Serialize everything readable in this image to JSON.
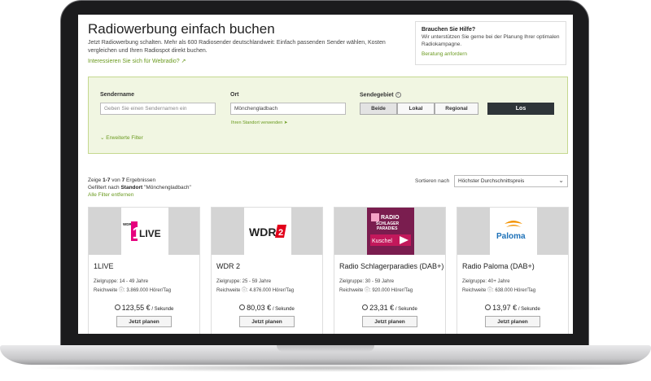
{
  "page": {
    "title": "Radiowerbung einfach buchen",
    "intro": "Jetzt Radiowerbung schalten. Mehr als 600 Radiosender deutschlandweit: Einfach passenden Sender wählen, Kosten vergleichen und Ihren Radiospot direkt buchen.",
    "webradio_link": "Interessieren Sie sich für Webradio?"
  },
  "help": {
    "title": "Brauchen Sie Hilfe?",
    "text": "Wir unterstützen Sie gerne bei der Planung Ihrer optimalen Radiokampagne.",
    "link": "Beratung anfordern"
  },
  "filter": {
    "sender_label": "Sendername",
    "sender_placeholder": "Geben Sie einen Sendernamen ein",
    "ort_label": "Ort",
    "ort_value": "Mönchengladbach",
    "location_link": "Ihren Standort verwenden",
    "gebiet_label": "Sendegebiet",
    "gebiet_options": [
      "Beide",
      "Lokal",
      "Regional"
    ],
    "submit": "Los",
    "advanced": "Erweiterte Filter"
  },
  "results": {
    "prefix": "Zeige ",
    "range": "1-7",
    "mid": " von ",
    "total": "7",
    "suffix": " Ergebnissen",
    "filtered_prefix": "Gefiltert nach ",
    "filtered_key": "Standort",
    "filtered_value": " \"Mönchengladbach\"",
    "reset": "Alle Filter entfernen",
    "sort_label": "Sortieren nach",
    "sort_value": "Höchster Durchschnittspreis"
  },
  "cards": [
    {
      "name": "1LIVE",
      "zielgruppe": "Zielgruppe: 14 - 49 Jahre",
      "reichweite": "Reichweite ⓘ: 3.869.000 Hörer/Tag",
      "price": "123,55 €",
      "unit": " / Sekunde",
      "button": "Jetzt planen",
      "logo": "1LIVE"
    },
    {
      "name": "WDR 2",
      "zielgruppe": "Zielgruppe: 25 - 59 Jahre",
      "reichweite": "Reichweite ⓘ: 4.876.000 Hörer/Tag",
      "price": "80,03 €",
      "unit": " / Sekunde",
      "button": "Jetzt planen",
      "logo": "WDR 2"
    },
    {
      "name": "Radio Schlagerparadies (DAB+)",
      "zielgruppe": "Zielgruppe: 30 - 59 Jahre",
      "reichweite": "Reichweite ⓘ: 920.000 Hörer/Tag",
      "price": "23,31 €",
      "unit": " / Sekunde",
      "button": "Jetzt planen",
      "logo": "RADIO SCHLAGER PARADIES Kuschelsongs"
    },
    {
      "name": "Radio Paloma (DAB+)",
      "zielgruppe": "Zielgruppe: 40+ Jahre",
      "reichweite": "Reichweite ⓘ: 638.000 Hörer/Tag",
      "price": "13,97 €",
      "unit": " / Sekunde",
      "button": "Jetzt planen",
      "logo": "Radio Paloma"
    }
  ],
  "colors": {
    "accent": "#6a9a1f",
    "filter_bg": "#f1f6e2",
    "button_dark": "#2f3539"
  }
}
